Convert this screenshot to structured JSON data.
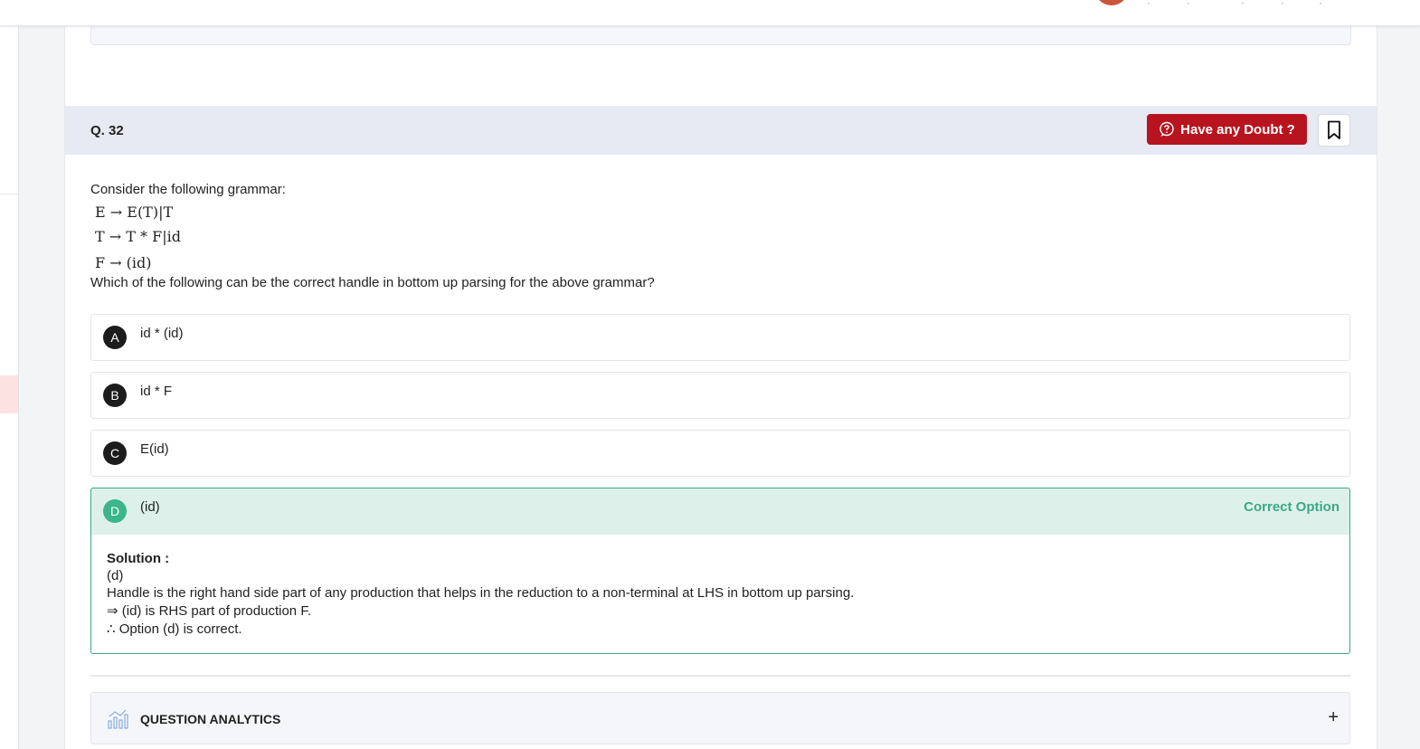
{
  "question": {
    "number": "Q. 32",
    "intro": "Consider the following grammar:",
    "grammar": [
      "E → E(T)|T",
      "T → T * F|id",
      "F → (id)"
    ],
    "prompt": "Which of the following can be the correct handle in bottom up parsing for the above grammar?"
  },
  "actions": {
    "doubt_label": "Have any Doubt ?"
  },
  "options": [
    {
      "letter": "A",
      "text": "id * (id)"
    },
    {
      "letter": "B",
      "text": "id * F"
    },
    {
      "letter": "C",
      "text": "E(id)"
    },
    {
      "letter": "D",
      "text": "(id)",
      "status": "Correct Option"
    }
  ],
  "solution": {
    "title": "Solution :",
    "lines": [
      "(d)",
      "Handle is the right hand side part of any production that helps in the reduction to a non-terminal at LHS in bottom up parsing.",
      "⇒ (id) is RHS part of production F.",
      "∴ Option (d) is correct."
    ]
  },
  "analytics": {
    "label": "QUESTION ANALYTICS",
    "expand_symbol": "+"
  },
  "colors": {
    "doubt_button": "#b8141f",
    "correct_green": "#3aa886",
    "correct_bg": "#ddf1ea",
    "header_bg": "#e8eaf3"
  }
}
